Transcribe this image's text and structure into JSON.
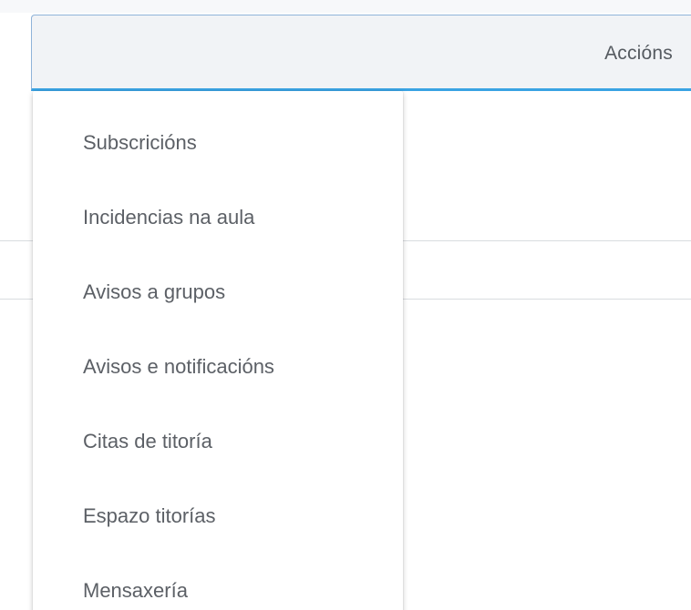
{
  "header": {
    "actions_label": "Accións"
  },
  "menu": {
    "items": [
      {
        "label": "Subscricións"
      },
      {
        "label": "Incidencias na aula"
      },
      {
        "label": "Avisos a grupos"
      },
      {
        "label": "Avisos e notificacións"
      },
      {
        "label": "Citas de titoría"
      },
      {
        "label": "Espazo titorías"
      },
      {
        "label": "Mensaxería"
      }
    ]
  },
  "colors": {
    "accent": "#3aa3e3",
    "header_bg": "#f1f3f6",
    "menu_text": "#5c6066"
  }
}
